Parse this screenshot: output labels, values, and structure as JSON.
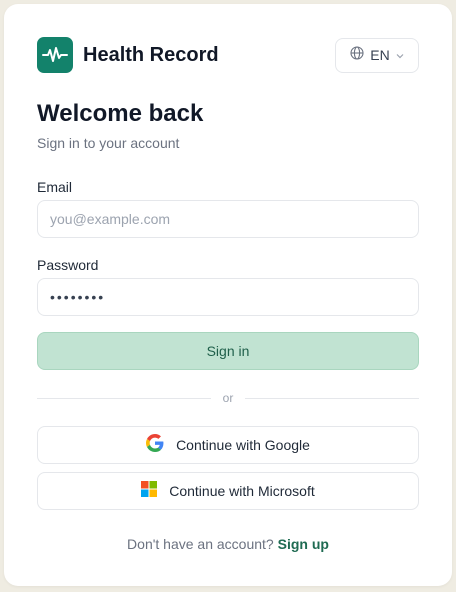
{
  "brand": {
    "name": "Health Record",
    "logo_icon": "pulse-icon",
    "accent": "#13826b"
  },
  "language": {
    "selected": "EN",
    "icon": "globe-icon"
  },
  "heading": {
    "title": "Welcome back",
    "subtitle": "Sign in to your account"
  },
  "form": {
    "email_label": "Email",
    "email_placeholder": "you@example.com",
    "email_value": "",
    "password_label": "Password",
    "password_value": "12345678",
    "submit_label": "Sign in"
  },
  "divider": {
    "text": "or"
  },
  "oauth": {
    "google_label": "Continue with Google",
    "microsoft_label": "Continue with Microsoft"
  },
  "footer": {
    "prompt": "Don't have an account?",
    "signup_label": "Sign up"
  }
}
